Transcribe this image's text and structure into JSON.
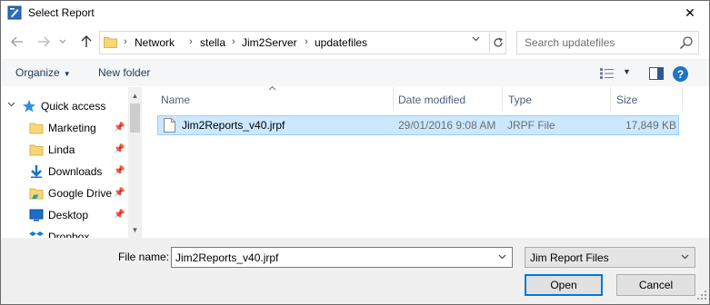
{
  "window": {
    "title": "Select Report",
    "close_glyph": "✕"
  },
  "nav": {
    "back_icon": "back-arrow-icon",
    "forward_icon": "forward-arrow-icon",
    "recent_icon": "chevron-down-icon",
    "up_icon": "up-arrow-icon",
    "breadcrumbs": [
      "Network",
      "stella",
      "Jim2Server",
      "updatefiles"
    ],
    "search_placeholder": "Search updatefiles"
  },
  "toolbar": {
    "organize_label": "Organize",
    "new_folder_label": "New folder"
  },
  "sidebar": {
    "items": [
      {
        "label": "Quick access",
        "icon": "star-icon",
        "expandable": true,
        "pinned": false
      },
      {
        "label": "Marketing",
        "icon": "folder-icon",
        "expandable": false,
        "pinned": true
      },
      {
        "label": "Linda",
        "icon": "folder-icon",
        "expandable": false,
        "pinned": true
      },
      {
        "label": "Downloads",
        "icon": "download-icon",
        "expandable": false,
        "pinned": true
      },
      {
        "label": "Google Drive",
        "icon": "google-drive-icon",
        "expandable": false,
        "pinned": true
      },
      {
        "label": "Desktop",
        "icon": "desktop-icon",
        "expandable": false,
        "pinned": true
      },
      {
        "label": "Dropbox",
        "icon": "dropbox-icon",
        "expandable": false,
        "pinned": false
      }
    ]
  },
  "file_list": {
    "columns": [
      "Name",
      "Date modified",
      "Type",
      "Size"
    ],
    "rows": [
      {
        "name": "Jim2Reports_v40.jrpf",
        "date_modified": "29/01/2016 9:08 AM",
        "type": "JRPF File",
        "size": "17,849 KB",
        "selected": true
      }
    ]
  },
  "footer": {
    "file_name_label": "File name:",
    "file_name_value": "Jim2Reports_v40.jrpf",
    "file_type_value": "Jim Report Files",
    "open_label": "Open",
    "cancel_label": "Cancel"
  },
  "colors": {
    "selection_bg": "#cce8ff",
    "selection_border": "#99d1ff",
    "accent": "#0078d7",
    "toolbar_text": "#1e395b",
    "header_text": "#4c607a"
  }
}
